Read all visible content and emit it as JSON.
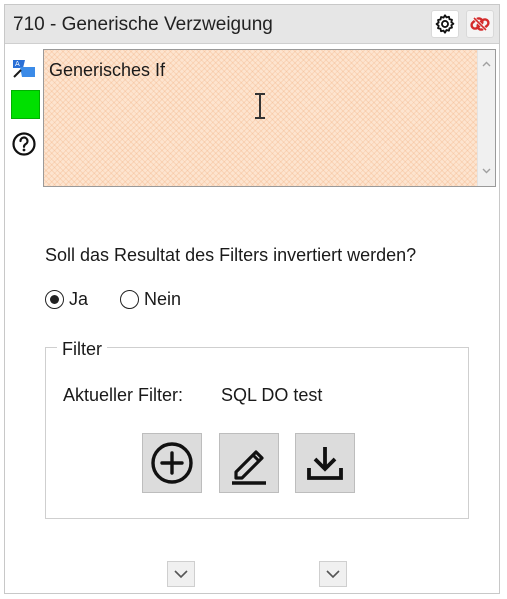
{
  "window": {
    "title": "710 - Generische Verzweigung",
    "settings_icon": "gear-icon",
    "remove_icon": "remove-link-icon"
  },
  "sidebar": {
    "icons": [
      "translate-icon",
      "color-swatch",
      "help-icon"
    ],
    "color": "#00e000"
  },
  "description": {
    "value": "Generisches If",
    "background_color": "#fde4cf"
  },
  "invert": {
    "question": "Soll das Resultat des Filters invertiert werden?",
    "options": [
      {
        "label": "Ja",
        "selected": true
      },
      {
        "label": "Nein",
        "selected": false
      }
    ]
  },
  "filter": {
    "legend": "Filter",
    "current_label": "Aktueller Filter:",
    "current_value": "SQL DO test",
    "actions": [
      "add-icon",
      "edit-icon",
      "download-icon"
    ]
  },
  "footer": {
    "chevrons": [
      "chevron-down-icon",
      "chevron-down-icon"
    ]
  }
}
